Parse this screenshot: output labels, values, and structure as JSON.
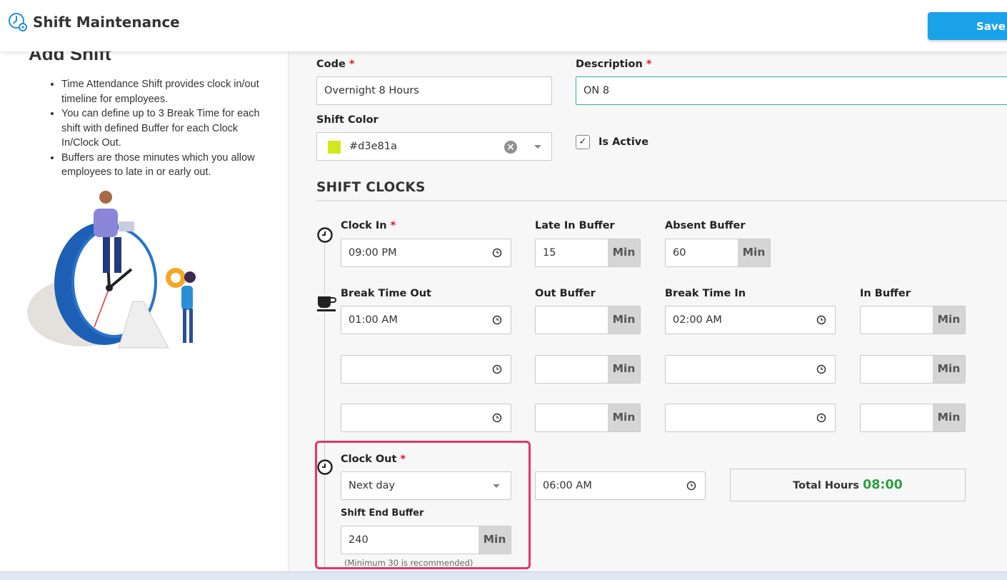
{
  "header": {
    "title": "Shift Maintenance",
    "save_label": "Save"
  },
  "info_panel": {
    "title": "Add Shift",
    "bullets": [
      "Time Attendance Shift provides clock in/out timeline for employees.",
      "You can define up to 3 Break Time for each shift with defined Buffer for each Clock In/Clock Out.",
      "Buffers are those minutes which you allow employees to late in or early out."
    ]
  },
  "form": {
    "code": {
      "label": "Code",
      "required": "*",
      "value": "Overnight 8 Hours"
    },
    "description": {
      "label": "Description",
      "required": "*",
      "value": "ON 8"
    },
    "shift_color": {
      "label": "Shift Color",
      "value": "#d3e81a",
      "swatch": "#d3e81a"
    },
    "is_active": {
      "label": "Is Active",
      "checked": true,
      "mark": "✓"
    }
  },
  "shift_clocks": {
    "title": "SHIFT CLOCKS",
    "clock_in": {
      "label": "Clock In",
      "required": "*",
      "value": "09:00 PM"
    },
    "late_in_buffer": {
      "label": "Late In Buffer",
      "value": "15",
      "unit": "Min"
    },
    "absent_buffer": {
      "label": "Absent Buffer",
      "value": "60",
      "unit": "Min"
    },
    "breaks": {
      "labels": {
        "out": "Break Time Out",
        "out_buffer": "Out Buffer",
        "in": "Break Time In",
        "in_buffer": "In Buffer"
      },
      "rows": [
        {
          "out": "01:00 AM",
          "out_buffer": "",
          "in": "02:00 AM",
          "in_buffer": ""
        },
        {
          "out": "",
          "out_buffer": "",
          "in": "",
          "in_buffer": ""
        },
        {
          "out": "",
          "out_buffer": "",
          "in": "",
          "in_buffer": ""
        }
      ],
      "unit": "Min"
    },
    "clock_out": {
      "label": "Clock Out",
      "required": "*",
      "day": "Next day",
      "time": "06:00 AM"
    },
    "shift_end_buffer": {
      "label": "Shift End Buffer",
      "value": "240",
      "unit": "Min",
      "hint": "(Minimum 30 is recommended)"
    },
    "total_hours": {
      "label": "Total Hours",
      "value": "08:00"
    }
  },
  "colors": {
    "accent": "#1aa3e8",
    "required": "#e0112b",
    "highlight": "#e5356a",
    "total_value": "#2e9e46"
  }
}
